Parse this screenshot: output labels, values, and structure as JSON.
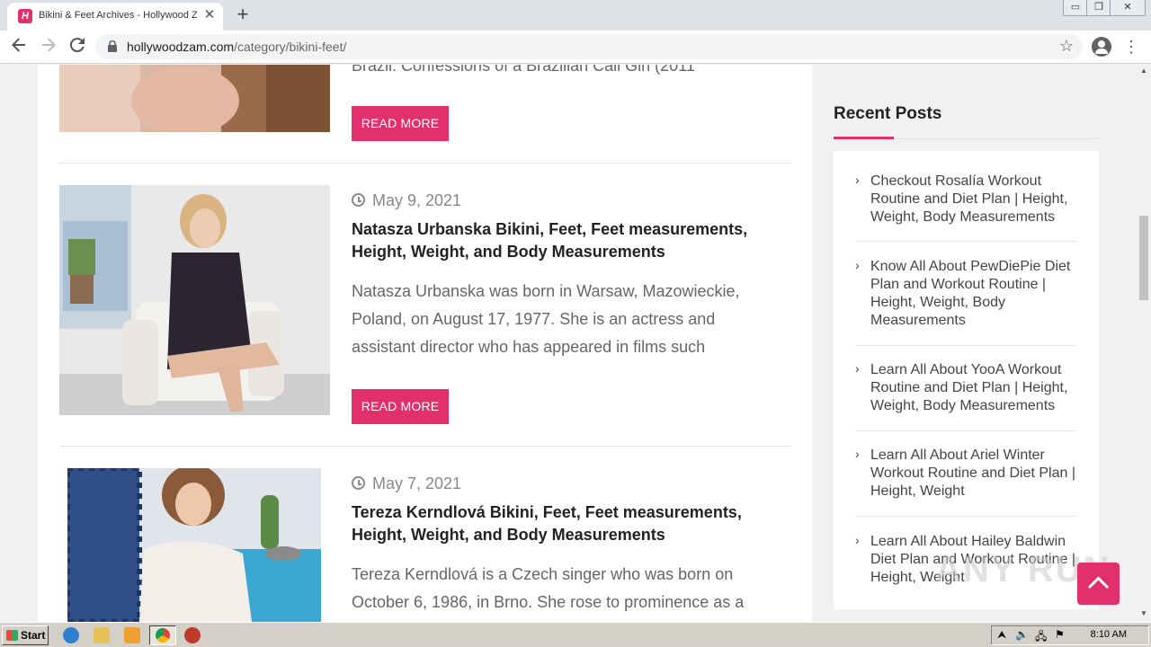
{
  "browser": {
    "tab_title": "Bikini & Feet Archives - Hollywood Zam",
    "tab_favicon_letter": "H",
    "new_tab_symbol": "+",
    "close_symbol": "✕",
    "url_host": "hollywoodzam.com",
    "url_path": "/category/bikini-feet/",
    "window_controls": [
      "▭",
      "❐",
      "✕"
    ]
  },
  "posts": [
    {
      "excerpt_tail": "Brazil: Confessions of a Brazilian Call Girl (2011",
      "read_more": "READ MORE"
    },
    {
      "date": "May 9, 2021",
      "title": "Natasza Urbanska Bikini, Feet, Feet measurements, Height, Weight, and Body Measurements",
      "excerpt": "Natasza Urbanska was born in Warsaw, Mazowieckie, Poland, on August 17, 1977. She is an actress and assistant director who has appeared in films such",
      "read_more": "READ MORE"
    },
    {
      "date": "May 7, 2021",
      "title": "Tereza Kerndlová Bikini, Feet, Feet measurements, Height, Weight, and Body Measurements",
      "excerpt": "Tereza Kerndlová is a Czech singer who was born on October 6, 1986, in Brno. She rose to prominence as a"
    }
  ],
  "sidebar": {
    "widget_title": "Recent Posts",
    "items": [
      "Checkout Rosalía Workout Routine and Diet Plan | Height, Weight, Body Measurements",
      "Know All About PewDiePie Diet Plan and Workout Routine | Height, Weight, Body Measurements",
      "Learn All About YooA Workout Routine and Diet Plan | Height, Weight, Body Measurements",
      "Learn All About Ariel Winter Workout Routine and Diet Plan | Height, Weight",
      "Learn All About Hailey Baldwin Diet Plan and Workout Routine | Height, Weight"
    ]
  },
  "watermark": "ANY RUN",
  "taskbar": {
    "start_label": "Start",
    "time": "8:10 AM"
  },
  "colors": {
    "accent": "#e2306c"
  }
}
